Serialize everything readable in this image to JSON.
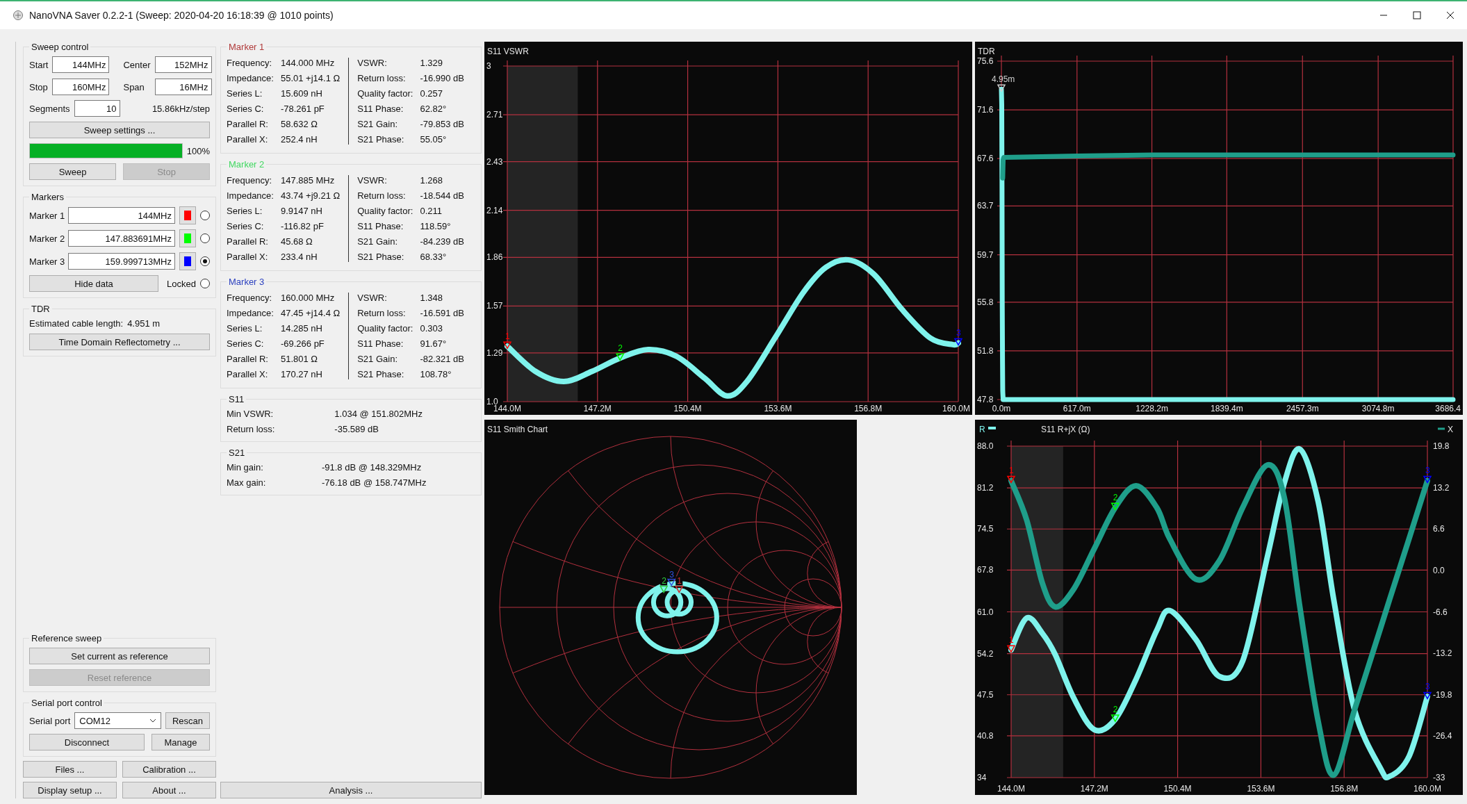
{
  "window": {
    "title": "NanoVNA Saver 0.2.2-1 (Sweep: 2020-04-20 16:18:39 @ 1010 points)"
  },
  "sweep_control": {
    "title": "Sweep control",
    "fields": [
      {
        "label": "Start",
        "value": "144MHz"
      },
      {
        "label": "Center",
        "value": "152MHz"
      },
      {
        "label": "Stop",
        "value": "160MHz"
      },
      {
        "label": "Span",
        "value": "16MHz"
      }
    ],
    "segments": {
      "label": "Segments",
      "value": "10"
    },
    "step": "15.86kHz/step",
    "settings_button": "Sweep settings ...",
    "progress": {
      "level": 1,
      "text": "100%"
    },
    "buttons": [
      {
        "label": "Sweep",
        "disabled": false
      },
      {
        "label": "Stop",
        "disabled": true
      }
    ]
  },
  "markers": {
    "title": "Markers",
    "items": [
      {
        "label": "Marker 1",
        "value": "144MHz",
        "color": "#ff0000",
        "selected": false
      },
      {
        "label": "Marker 2",
        "value": "147.883691MHz",
        "color": "#00ff00",
        "selected": false
      },
      {
        "label": "Marker 3",
        "value": "159.999713MHz",
        "color": "#0000ff",
        "selected": true
      }
    ],
    "hide_button": "Hide data",
    "locked": {
      "label": "Locked",
      "checked": false
    }
  },
  "tdr": {
    "title": "TDR",
    "label": "Estimated cable length:",
    "value": "4.951 m",
    "button": "Time Domain Reflectometry ..."
  },
  "reference_sweep": {
    "title": "Reference sweep",
    "buttons": [
      {
        "label": "Set current as reference",
        "disabled": false
      },
      {
        "label": "Reset reference",
        "disabled": true
      }
    ]
  },
  "serial_port": {
    "title": "Serial port control",
    "label": "Serial port",
    "value": "COM12",
    "rescan": "Rescan",
    "buttons": [
      "Disconnect",
      "Manage"
    ]
  },
  "footer_buttons": [
    "Files ...",
    "Calibration ...",
    "Display setup ...",
    "About ...",
    "Analysis ..."
  ],
  "marker_data": [
    {
      "title": "Marker 1",
      "color": "#b03a3a",
      "left": [
        {
          "label": "Frequency:",
          "value": "144.000 MHz"
        },
        {
          "label": "Impedance:",
          "value": "55.01 +j14.1 Ω"
        },
        {
          "label": "Series L:",
          "value": "15.609 nH"
        },
        {
          "label": "Series C:",
          "value": "-78.261 pF"
        },
        {
          "label": "Parallel R:",
          "value": "58.632 Ω"
        },
        {
          "label": "Parallel X:",
          "value": "252.4 nH"
        }
      ],
      "right": [
        {
          "label": "VSWR:",
          "value": "1.329"
        },
        {
          "label": "Return loss:",
          "value": "-16.990 dB"
        },
        {
          "label": "Quality factor:",
          "value": "0.257"
        },
        {
          "label": "S11 Phase:",
          "value": "62.82°"
        },
        {
          "label": "S21 Gain:",
          "value": "-79.853 dB"
        },
        {
          "label": "S21 Phase:",
          "value": "55.05°"
        }
      ]
    },
    {
      "title": "Marker 2",
      "color": "#40d860",
      "left": [
        {
          "label": "Frequency:",
          "value": "147.885 MHz"
        },
        {
          "label": "Impedance:",
          "value": "43.74 +j9.21 Ω"
        },
        {
          "label": "Series L:",
          "value": "9.9147 nH"
        },
        {
          "label": "Series C:",
          "value": "-116.82 pF"
        },
        {
          "label": "Parallel R:",
          "value": "45.68 Ω"
        },
        {
          "label": "Parallel X:",
          "value": "233.4 nH"
        }
      ],
      "right": [
        {
          "label": "VSWR:",
          "value": "1.268"
        },
        {
          "label": "Return loss:",
          "value": "-18.544 dB"
        },
        {
          "label": "Quality factor:",
          "value": "0.211"
        },
        {
          "label": "S11 Phase:",
          "value": "118.59°"
        },
        {
          "label": "S21 Gain:",
          "value": "-84.239 dB"
        },
        {
          "label": "S21 Phase:",
          "value": "68.33°"
        }
      ]
    },
    {
      "title": "Marker 3",
      "color": "#2a3fbf",
      "left": [
        {
          "label": "Frequency:",
          "value": "160.000 MHz"
        },
        {
          "label": "Impedance:",
          "value": "47.45 +j14.4 Ω"
        },
        {
          "label": "Series L:",
          "value": "14.285 nH"
        },
        {
          "label": "Series C:",
          "value": "-69.266 pF"
        },
        {
          "label": "Parallel R:",
          "value": "51.801 Ω"
        },
        {
          "label": "Parallel X:",
          "value": "170.27 nH"
        }
      ],
      "right": [
        {
          "label": "VSWR:",
          "value": "1.348"
        },
        {
          "label": "Return loss:",
          "value": "-16.591 dB"
        },
        {
          "label": "Quality factor:",
          "value": "0.303"
        },
        {
          "label": "S11 Phase:",
          "value": "91.67°"
        },
        {
          "label": "S21 Gain:",
          "value": "-82.321 dB"
        },
        {
          "label": "S21 Phase:",
          "value": "108.78°"
        }
      ]
    }
  ],
  "summaries": [
    {
      "title": "S11",
      "rows": [
        {
          "label": "Min VSWR:",
          "value": "1.034 @ 151.802MHz"
        },
        {
          "label": "Return loss:",
          "value": "-35.589 dB"
        }
      ]
    },
    {
      "title": "S21",
      "rows": [
        {
          "label": "Min gain:",
          "value": "-91.8 dB @ 148.329MHz"
        },
        {
          "label": "Max gain:",
          "value": "-76.18 dB @ 158.747MHz"
        }
      ]
    }
  ],
  "vswr_chart": {
    "title": "S11 VSWR",
    "chart_data": {
      "type": "line",
      "x": [
        144,
        145,
        146,
        147,
        148,
        149,
        150,
        151,
        151.8,
        152.5,
        153.5,
        154.5,
        155.3,
        156.1,
        157,
        158,
        159,
        159.8,
        160
      ],
      "series": [
        {
          "color": "#7ff3ec",
          "values": [
            1.33,
            1.18,
            1.12,
            1.18,
            1.26,
            1.31,
            1.27,
            1.14,
            1.034,
            1.12,
            1.38,
            1.65,
            1.8,
            1.845,
            1.76,
            1.55,
            1.38,
            1.34,
            1.35
          ]
        }
      ],
      "xlim": [
        144,
        160
      ],
      "ylim": [
        1.0,
        3
      ],
      "xticks": [
        {
          "value": 144,
          "label": "144.0M"
        },
        {
          "value": 147.2,
          "label": "147.2M"
        },
        {
          "value": 150.4,
          "label": "150.4M"
        },
        {
          "value": 153.6,
          "label": "153.6M"
        },
        {
          "value": 156.8,
          "label": "156.8M"
        },
        {
          "value": 160,
          "label": "160.0M"
        }
      ],
      "yticks": [
        {
          "value": 1.0,
          "label": "1.0"
        },
        {
          "value": 1.29,
          "label": "1.29"
        },
        {
          "value": 1.57,
          "label": "1.57"
        },
        {
          "value": 1.86,
          "label": "1.86"
        },
        {
          "value": 2.14,
          "label": "2.14"
        },
        {
          "value": 2.43,
          "label": "2.43"
        },
        {
          "value": 2.71,
          "label": "2.71"
        },
        {
          "value": 3,
          "label": "3"
        }
      ],
      "grid": true,
      "bands": [
        {
          "axis": "x",
          "from": 144,
          "to": 146.5
        }
      ],
      "annotations": [
        {
          "x": 144,
          "y": 1.33,
          "text": "1"
        },
        {
          "x": 148,
          "y": 1.26,
          "text": "2"
        },
        {
          "x": 160,
          "y": 1.35,
          "text": "3"
        }
      ]
    }
  },
  "tdr_chart": {
    "title": "TDR",
    "chart_data": {
      "type": "line",
      "x": [
        0,
        3,
        5,
        7,
        9,
        11,
        14,
        20,
        617,
        1228.2,
        1839.4,
        2457.3,
        3074.8,
        3686.4
      ],
      "series": [
        {
          "color": "#7ff3ec",
          "values": [
            73.3,
            72,
            65,
            56,
            51,
            48.5,
            47.8,
            47.8,
            47.8,
            47.8,
            47.8,
            47.8,
            47.8,
            47.8
          ]
        },
        {
          "color": "#1f9e8a",
          "values": [
            null,
            null,
            null,
            null,
            null,
            66,
            67.5,
            67.7,
            67.8,
            67.9,
            67.9,
            67.9,
            67.9,
            67.9
          ]
        }
      ],
      "xlim": [
        0,
        3686.4
      ],
      "ylim": [
        47.8,
        75.6
      ],
      "xticks": [
        {
          "value": 0,
          "label": "0.0m"
        },
        {
          "value": 617,
          "label": "617.0m"
        },
        {
          "value": 1228.2,
          "label": "1228.2m"
        },
        {
          "value": 1839.4,
          "label": "1839.4m"
        },
        {
          "value": 2457.3,
          "label": "2457.3m"
        },
        {
          "value": 3074.8,
          "label": "3074.8m"
        },
        {
          "value": 3686.4,
          "label": "3686.4"
        }
      ],
      "yticks": [
        {
          "value": 47.8,
          "label": "47.8"
        },
        {
          "value": 51.8,
          "label": "51.8"
        },
        {
          "value": 55.8,
          "label": "55.8"
        },
        {
          "value": 59.7,
          "label": "59.7"
        },
        {
          "value": 63.7,
          "label": "63.7"
        },
        {
          "value": 67.6,
          "label": "67.6"
        },
        {
          "value": 71.6,
          "label": "71.6"
        },
        {
          "value": 75.6,
          "label": "75.6"
        }
      ],
      "grid": true,
      "annotations": [
        {
          "x": 0,
          "y": 73.3,
          "text": "4.95m"
        }
      ]
    }
  },
  "smith_chart": {
    "title": "S11 Smith Chart",
    "markers": [
      {
        "text": "1",
        "color": "#d03030"
      },
      {
        "text": "2",
        "color": "#30d040"
      },
      {
        "text": "3",
        "color": "#3050e0"
      }
    ]
  },
  "rjx_chart": {
    "title": "S11 R+jX (Ω)",
    "chart_data": {
      "type": "line",
      "x": [
        144,
        144.6,
        145.2,
        145.7,
        146.4,
        147.2,
        148,
        148.8,
        149.6,
        150.1,
        151.1,
        152,
        152.9,
        153.85,
        154.5,
        155.1,
        155.8,
        156.4,
        157.2,
        158.2,
        158.55,
        159.3,
        160
      ],
      "series": [
        {
          "name": "R",
          "color": "#7ff3ec",
          "values": [
            54.8,
            60,
            57.5,
            54,
            47,
            41.8,
            43.5,
            50,
            58,
            61.2,
            56.5,
            50.5,
            53,
            70,
            82,
            87.5,
            79,
            63,
            45,
            35.5,
            34.2,
            37.5,
            47.2
          ]
        },
        {
          "name": "X",
          "color": "#1f9e8a",
          "axis": "y2",
          "values": [
            14.3,
            8,
            -2,
            -5.8,
            -3,
            3.5,
            10,
            13.5,
            10,
            5,
            -1.4,
            1.5,
            10,
            16.8,
            11.6,
            -5.9,
            -24,
            -32.6,
            -22.2,
            -9.2,
            -4.6,
            5.1,
            14.3
          ]
        }
      ],
      "xlim": [
        144,
        160
      ],
      "ylim": [
        34,
        88
      ],
      "y2lim": [
        -33,
        19.8
      ],
      "xticks": [
        {
          "value": 144,
          "label": "144.0M"
        },
        {
          "value": 147.2,
          "label": "147.2M"
        },
        {
          "value": 150.4,
          "label": "150.4M"
        },
        {
          "value": 153.6,
          "label": "153.6M"
        },
        {
          "value": 156.8,
          "label": "156.8M"
        },
        {
          "value": 160,
          "label": "160.0M"
        }
      ],
      "yticks": [
        {
          "value": 34,
          "label": "34"
        },
        {
          "value": 40.8,
          "label": "40.8"
        },
        {
          "value": 47.5,
          "label": "47.5"
        },
        {
          "value": 54.2,
          "label": "54.2"
        },
        {
          "value": 61.0,
          "label": "61.0"
        },
        {
          "value": 67.8,
          "label": "67.8"
        },
        {
          "value": 74.5,
          "label": "74.5"
        },
        {
          "value": 81.2,
          "label": "81.2"
        },
        {
          "value": 88.0,
          "label": "88.0"
        }
      ],
      "y2ticks": [
        {
          "value": -33,
          "label": "-33"
        },
        {
          "value": -26.4,
          "label": "-26.4"
        },
        {
          "value": -19.8,
          "label": "-19.8"
        },
        {
          "value": -13.2,
          "label": "-13.2"
        },
        {
          "value": -6.6,
          "label": "-6.6"
        },
        {
          "value": 0,
          "label": "0.0"
        },
        {
          "value": 6.6,
          "label": "6.6"
        },
        {
          "value": 13.2,
          "label": "13.2"
        },
        {
          "value": 19.8,
          "label": "19.8"
        }
      ],
      "grid": true,
      "bands": [
        {
          "axis": "x",
          "from": 144,
          "to": 146
        }
      ],
      "annotations": [
        {
          "x": 144,
          "y": 54.8,
          "text": "1"
        },
        {
          "x": 144,
          "y": 82.4,
          "text": "1"
        },
        {
          "x": 148,
          "y": 43.5,
          "text": "2"
        },
        {
          "x": 148,
          "y": 78,
          "text": "2"
        },
        {
          "x": 160,
          "y": 47.2,
          "text": "3"
        },
        {
          "x": 160,
          "y": 82.4,
          "text": "3"
        }
      ]
    }
  }
}
